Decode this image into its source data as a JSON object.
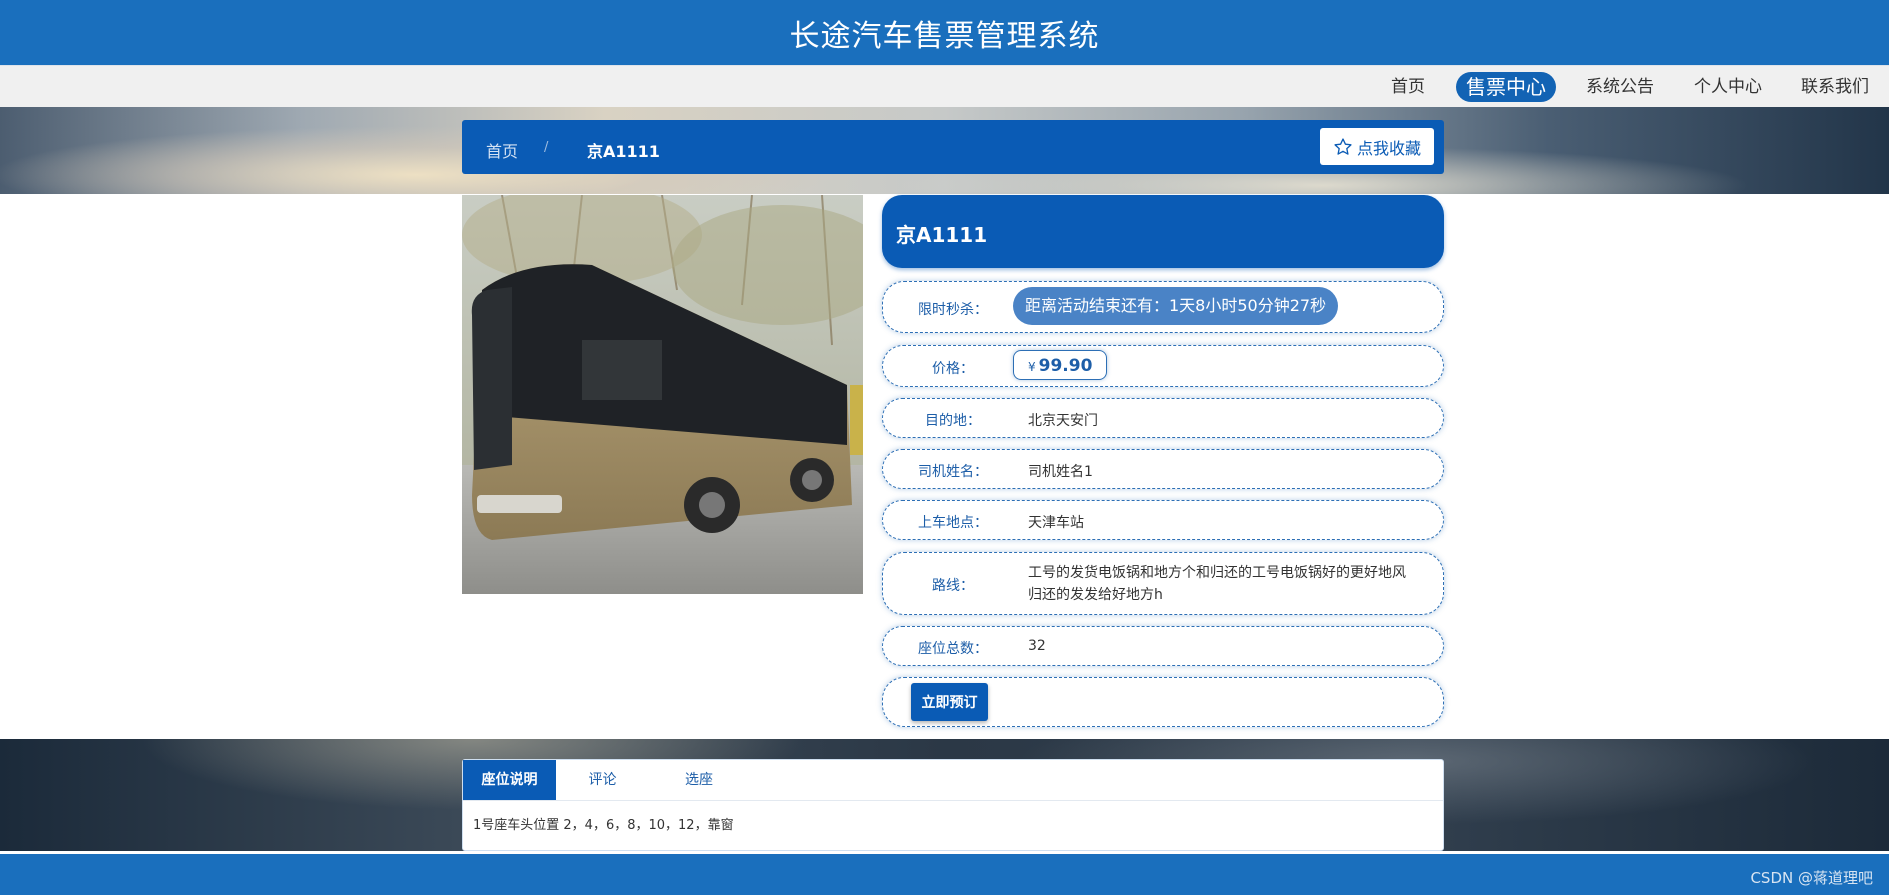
{
  "header": {
    "title": "长途汽车售票管理系统"
  },
  "nav": {
    "items": [
      {
        "label": "首页",
        "active": false
      },
      {
        "label": "售票中心",
        "active": true
      },
      {
        "label": "系统公告",
        "active": false
      },
      {
        "label": "个人中心",
        "active": false
      },
      {
        "label": "联系我们",
        "active": false
      }
    ]
  },
  "breadcrumb": {
    "home": "首页",
    "separator": "/",
    "current": "京A1111"
  },
  "favorite_button": {
    "label": "点我收藏",
    "icon": "star-outline-icon"
  },
  "product": {
    "name": "京A1111",
    "image_alt": "bus-photo",
    "flash_sale": {
      "label": "限时秒杀：",
      "countdown": "距离活动结束还有：1天8小时50分钟27秒"
    },
    "price": {
      "label": "价格：",
      "currency": "¥",
      "value": "99.90"
    },
    "destination": {
      "label": "目的地：",
      "value": "北京天安门"
    },
    "driver": {
      "label": "司机姓名：",
      "value": "司机姓名1"
    },
    "boarding": {
      "label": "上车地点：",
      "value": "天津车站"
    },
    "route": {
      "label": "路线：",
      "value": "工号的发货电饭锅和地方个和归还的工号电饭锅好的更好地风归还的发发给好地方h"
    },
    "seats": {
      "label": "座位总数：",
      "value": "32"
    },
    "book_button": "立即预订"
  },
  "tabs": {
    "items": [
      {
        "label": "座位说明",
        "active": true
      },
      {
        "label": "评论",
        "active": false
      },
      {
        "label": "选座",
        "active": false
      }
    ],
    "content": "1号座车头位置 2，4，6，8，10，12，靠窗"
  },
  "footer": {
    "watermark": "CSDN @蒋道理吧"
  },
  "colors": {
    "primary": "#0a5bb5",
    "header": "#1a6fbd",
    "accent_label": "#1d5ea8"
  }
}
